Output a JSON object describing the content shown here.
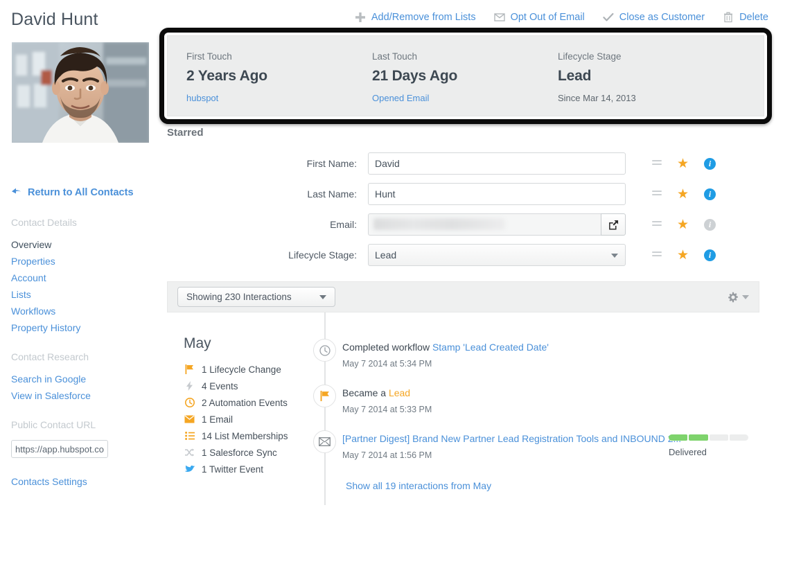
{
  "contact": {
    "name": "David Hunt"
  },
  "toolbar": {
    "items": [
      {
        "icon": "plus-icon",
        "label": "Add/Remove from Lists"
      },
      {
        "icon": "envelope-icon",
        "label": "Opt Out of Email"
      },
      {
        "icon": "check-icon",
        "label": "Close as Customer"
      },
      {
        "icon": "trash-icon",
        "label": "Delete"
      }
    ]
  },
  "summary": {
    "columns": [
      {
        "label": "First Touch",
        "value": "2 Years Ago",
        "sub": "hubspot",
        "sub_link": true
      },
      {
        "label": "Last Touch",
        "value": "21 Days Ago",
        "sub": "Opened Email",
        "sub_link": true
      },
      {
        "label": "Lifecycle Stage",
        "value": "Lead",
        "sub": "Since Mar 14, 2013",
        "sub_link": false
      }
    ]
  },
  "sidebar": {
    "return_label": "Return to All Contacts",
    "sections": [
      {
        "heading": "Contact Details",
        "items": [
          {
            "label": "Overview",
            "current": true
          },
          {
            "label": "Properties",
            "current": false
          },
          {
            "label": "Account",
            "current": false
          },
          {
            "label": "Lists",
            "current": false
          },
          {
            "label": "Workflows",
            "current": false
          },
          {
            "label": "Property History",
            "current": false
          }
        ]
      },
      {
        "heading": "Contact Research",
        "items": [
          {
            "label": "Search in Google",
            "current": false
          },
          {
            "label": "View in Salesforce",
            "current": false
          }
        ]
      }
    ],
    "public_url_heading": "Public Contact URL",
    "public_url_value": "https://app.hubspot.co",
    "settings_label": "Contacts Settings"
  },
  "form": {
    "section_title": "Starred",
    "rows": [
      {
        "label": "First Name:",
        "value": "David",
        "type": "text",
        "info_active": true
      },
      {
        "label": "Last Name:",
        "value": "Hunt",
        "type": "text",
        "info_active": true
      },
      {
        "label": "Email:",
        "value": "",
        "type": "email",
        "info_active": false
      },
      {
        "label": "Lifecycle Stage:",
        "value": "Lead",
        "type": "select",
        "info_active": true
      }
    ]
  },
  "interactions": {
    "filter_label": "Showing 230 Interactions"
  },
  "month": {
    "title": "May",
    "summary": [
      {
        "icon": "flag-icon",
        "label": "1 Lifecycle Change"
      },
      {
        "icon": "bolt-icon",
        "label": "4 Events"
      },
      {
        "icon": "clock-icon",
        "label": "2 Automation Events"
      },
      {
        "icon": "envelope-icon",
        "label": "1 Email"
      },
      {
        "icon": "list-icon",
        "label": "14 List Memberships"
      },
      {
        "icon": "shuffle-icon",
        "label": "1 Salesforce Sync"
      },
      {
        "icon": "twitter-icon",
        "label": "1 Twitter Event"
      }
    ]
  },
  "timeline": {
    "events": [
      {
        "icon": "clock-icon",
        "title_prefix": "Completed workflow ",
        "title_link": "Stamp 'Lead Created Date'",
        "title_suffix": "",
        "date": "May 7 2014 at 5:34 PM"
      },
      {
        "icon": "flag-icon",
        "title_prefix": "Became a ",
        "title_lead": "Lead",
        "date": "May 7 2014 at 5:33 PM"
      },
      {
        "icon": "envelope-icon",
        "title_link": "[Partner Digest] Brand New Partner Lead Registration Tools and INBOUND 2...",
        "date": "May 7 2014 at 1:56 PM",
        "progress_label": "Delivered",
        "progress_filled": 2,
        "progress_total": 4
      }
    ],
    "show_all_label": "Show all 19 interactions from May"
  },
  "colors": {
    "link": "#4a90d9",
    "accent_orange": "#f5a623",
    "info_blue": "#1f9ce4",
    "progress_green": "#7ed36c",
    "highlight_border": "#0b0b0b"
  }
}
